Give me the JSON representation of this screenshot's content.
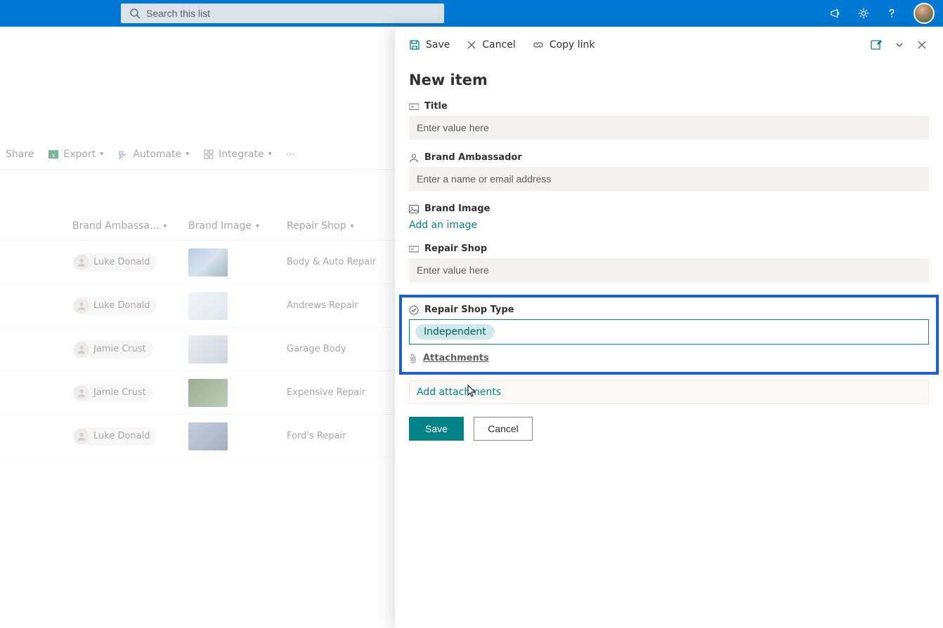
{
  "search": {
    "placeholder": "Search this list"
  },
  "toolbar": {
    "share": "Share",
    "export": "Export",
    "automate": "Automate",
    "integrate": "Integrate"
  },
  "columns": {
    "ambassador": "Brand Ambassa...",
    "image": "Brand Image",
    "repair": "Repair Shop"
  },
  "rows": [
    {
      "person": "Luke Donald",
      "repair": "Body & Auto Repair"
    },
    {
      "person": "Luke Donald",
      "repair": "Andrews Repair"
    },
    {
      "person": "Jamie Crust",
      "repair": "Garage Body"
    },
    {
      "person": "Jamie Crust",
      "repair": "Expensive Repair"
    },
    {
      "person": "Luke Donald",
      "repair": "Ford's Repair"
    }
  ],
  "panel": {
    "actions": {
      "save": "Save",
      "cancel": "Cancel",
      "copylink": "Copy link"
    },
    "title": "New item",
    "fields": {
      "title_label": "Title",
      "title_placeholder": "Enter value here",
      "ambassador_label": "Brand Ambassador",
      "ambassador_placeholder": "Enter a name or email address",
      "brandimage_label": "Brand Image",
      "brandimage_action": "Add an image",
      "repairshop_label": "Repair Shop",
      "repairshop_placeholder": "Enter value here",
      "repairtype_label": "Repair Shop Type",
      "repairtype_value": "Independent",
      "attachments_label": "Attachments",
      "attachments_action": "Add attachments"
    },
    "buttons": {
      "save": "Save",
      "cancel": "Cancel"
    }
  }
}
